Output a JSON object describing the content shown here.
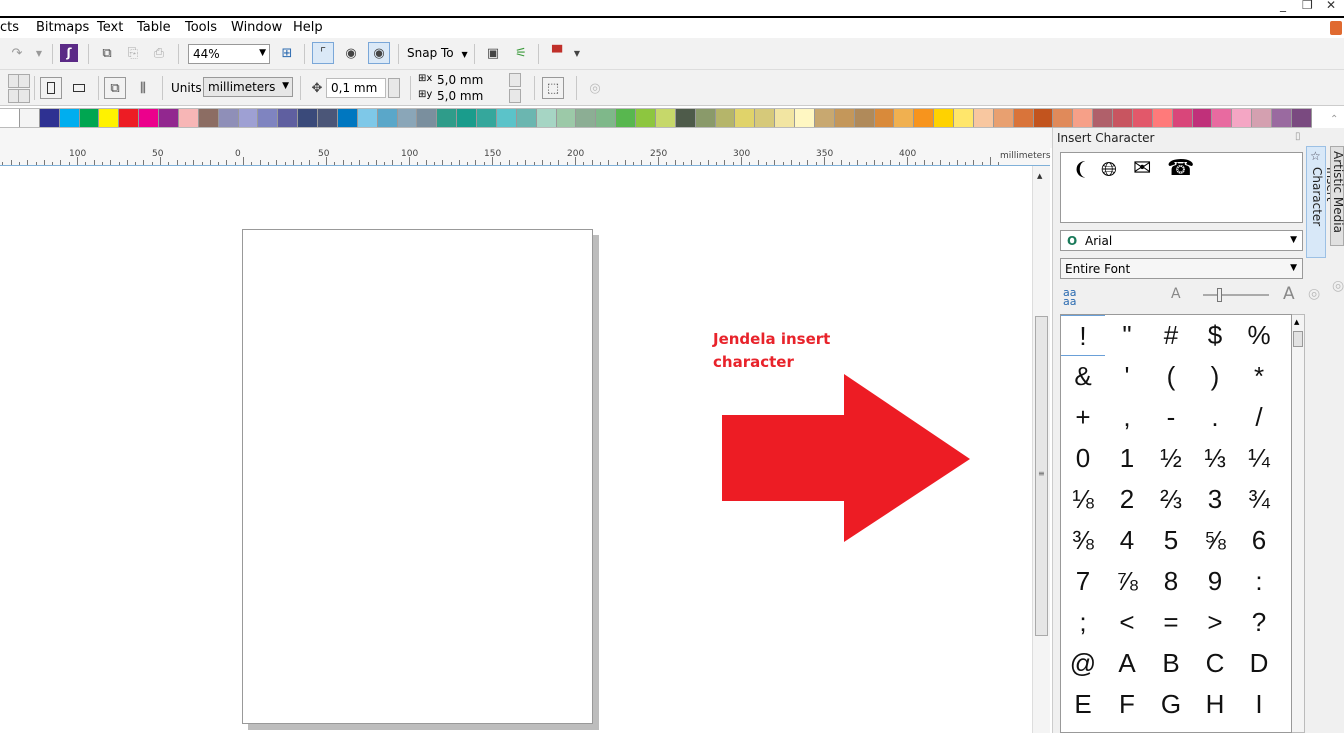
{
  "menu": {
    "items": [
      "cts",
      "Bitmaps",
      "Text",
      "Table",
      "Tools",
      "Window",
      "Help"
    ]
  },
  "toolbar": {
    "zoom_value": "44%",
    "snap_to_label": "Snap To",
    "units_label": "Units:",
    "units_value": "millimeters",
    "nudge_value": "0,1 mm",
    "dup_x_value": "5,0 mm",
    "dup_y_value": "5,0 mm"
  },
  "palette": {
    "colors": [
      "#ffffff",
      "#f4f4f4",
      "#2e3192",
      "#00aeef",
      "#00a651",
      "#fff200",
      "#ed1c24",
      "#ec008c",
      "#92278f",
      "#f7b6b6",
      "#8c6d63",
      "#8f8fb8",
      "#9ea0d3",
      "#7f84c0",
      "#5f5fa0",
      "#3a4a7a",
      "#4b5678",
      "#0077c0",
      "#7ec8e8",
      "#5aa7c9",
      "#8aa6b8",
      "#7a8f9e",
      "#2f9c8a",
      "#1a9c8c",
      "#35a79c",
      "#5bc3c9",
      "#6bb6b0",
      "#a6d5c4",
      "#9cc9a8",
      "#8cae94",
      "#7fb88a",
      "#58b74f",
      "#8dc63f",
      "#c6d86a",
      "#4e5b4a",
      "#8a9a6a",
      "#b5b56a",
      "#e0d36a",
      "#d6c97a",
      "#f2e5a2",
      "#fff7c2",
      "#c8a870",
      "#c4975a",
      "#b08a5a",
      "#d98a3a",
      "#f0b050",
      "#f7941d",
      "#ffd200",
      "#ffe66b",
      "#f8c7a0",
      "#e8a070",
      "#d9743a",
      "#c2541e",
      "#e08a5a",
      "#f6a088",
      "#b0606a",
      "#c85560",
      "#e2586a",
      "#ff7a7a",
      "#d9467a",
      "#c0307a",
      "#e86aa0",
      "#f4a6c4",
      "#d4a0b0",
      "#9a6aa0",
      "#7a4a80"
    ]
  },
  "ruler": {
    "unit_label": "millimeters",
    "labels": [
      "100",
      "50",
      "0",
      "50",
      "100",
      "150",
      "200",
      "250",
      "300",
      "350",
      "400"
    ]
  },
  "annotation": {
    "line1": "Jendela insert",
    "line2": "character",
    "color": "#ed1c24"
  },
  "docker": {
    "title": "Insert Character",
    "font_value": "Arial",
    "range_value": "Entire Font",
    "preview_icons": [
      "phone-handset-icon",
      "globe-icon",
      "envelope-icon",
      "telephone-icon"
    ],
    "characters": [
      "!",
      "\"",
      "#",
      "$",
      "%",
      "&",
      "'",
      "(",
      ")",
      "*",
      "+",
      ",",
      "-",
      ".",
      "/",
      "0",
      "1",
      "½",
      "⅓",
      "¼",
      "⅛",
      "2",
      "⅔",
      "3",
      "¾",
      "⅜",
      "4",
      "5",
      "⅝",
      "6",
      "7",
      "⅞",
      "8",
      "9",
      ":",
      ";",
      "<",
      "=",
      ">",
      "?",
      "@",
      "A",
      "B",
      "C",
      "D",
      "E",
      "F",
      "G",
      "H",
      "I"
    ]
  },
  "side_tabs": {
    "insert_character": "Insert Character",
    "artistic_media": "Artistic Media"
  }
}
